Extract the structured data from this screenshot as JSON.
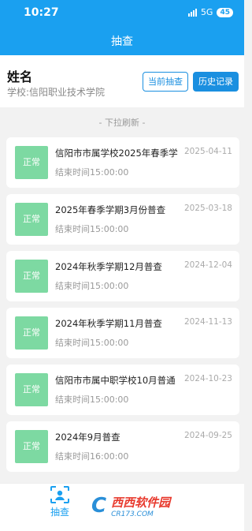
{
  "status": {
    "time": "10:27",
    "network": "5G",
    "battery": "45"
  },
  "nav": {
    "title": "抽查"
  },
  "header": {
    "name": "姓名",
    "school": "学校:信阳职业技术学院",
    "current_label": "当前抽查",
    "history_label": "历史记录"
  },
  "pull_hint": "- 下拉刷新 -",
  "items": [
    {
      "tag": "正常",
      "title": "信阳市市属学校2025年春季学",
      "date": "2025-04-11",
      "end": "结束时间15:00:00"
    },
    {
      "tag": "正常",
      "title": "2025年春季学期3月份普查",
      "date": "2025-03-18",
      "end": "结束时间15:00:00"
    },
    {
      "tag": "正常",
      "title": "2024年秋季学期12月普查",
      "date": "2024-12-04",
      "end": "结束时间15:00:00"
    },
    {
      "tag": "正常",
      "title": "2024年秋季学期11月普查",
      "date": "2024-11-13",
      "end": "结束时间15:00:00"
    },
    {
      "tag": "正常",
      "title": "信阳市市属中职学校10月普通",
      "date": "2024-10-23",
      "end": "结束时间15:00:00"
    },
    {
      "tag": "正常",
      "title": "2024年9月普查",
      "date": "2024-09-25",
      "end": "结束时间16:00:00"
    }
  ],
  "tabbar": {
    "main_label": "抽查",
    "main_icon": "scan-face-icon",
    "settings_icon": "gear-icon"
  },
  "watermark": {
    "logo": "C",
    "big": "西西软件园",
    "small": "CR173.COM"
  },
  "colors": {
    "primary": "#1aa0f0",
    "tag_green": "#7dd9a2"
  }
}
